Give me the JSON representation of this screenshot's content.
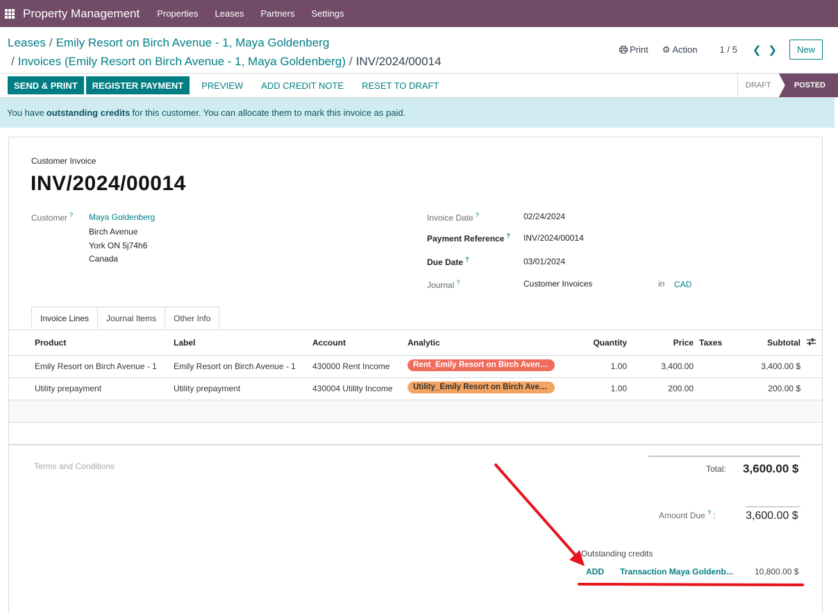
{
  "navbar": {
    "app_title": "Property Management",
    "menu": [
      "Properties",
      "Leases",
      "Partners",
      "Settings"
    ],
    "apps_icon": "grid-icon",
    "color": "#714b67"
  },
  "breadcrumb": {
    "item1": "Leases",
    "item2": "Emily Resort on Birch Avenue - 1, Maya Goldenberg",
    "item3": "Invoices (Emily Resort on Birch Avenue - 1, Maya Goldenberg)",
    "current": "INV/2024/00014"
  },
  "control": {
    "print_label": "Print",
    "print_icon": "printer-icon",
    "action_label": "Action",
    "action_icon": "gear-icon",
    "pager": "1 / 5",
    "new_label": "New"
  },
  "statusbar": {
    "buttons": [
      "SEND & PRINT",
      "REGISTER PAYMENT",
      "PREVIEW",
      "ADD CREDIT NOTE",
      "RESET TO DRAFT"
    ],
    "states": [
      "DRAFT",
      "POSTED"
    ],
    "active_state": "POSTED"
  },
  "alert": {
    "prefix": "You have",
    "bold": "outstanding credits",
    "suffix": "for this customer. You can allocate them to mark this invoice as paid."
  },
  "invoice": {
    "type_label": "Customer Invoice",
    "name": "INV/2024/00014",
    "customer_label": "Customer",
    "customer_name": "Maya Goldenberg",
    "address_line1": "Birch Avenue",
    "address_line2": "York ON 5j74h6",
    "address_line3": "Canada",
    "invoice_date_label": "Invoice Date",
    "invoice_date": "02/24/2024",
    "payment_ref_label": "Payment Reference",
    "payment_ref": "INV/2024/00014",
    "due_date_label": "Due Date",
    "due_date": "03/01/2024",
    "journal_label": "Journal",
    "journal": "Customer Invoices",
    "in_label": "in",
    "currency": "CAD"
  },
  "tabs": [
    "Invoice Lines",
    "Journal Items",
    "Other Info"
  ],
  "lines": {
    "headers": {
      "product": "Product",
      "label": "Label",
      "account": "Account",
      "analytic": "Analytic",
      "quantity": "Quantity",
      "price": "Price",
      "taxes": "Taxes",
      "subtotal": "Subtotal"
    },
    "rows": [
      {
        "product": "Emily Resort on Birch Avenue - 1",
        "label": "Emily Resort on Birch Avenue - 1",
        "account": "430000 Rent Income",
        "analytic": "Rent_Emily Resort on Birch Avenue...",
        "analytic_color": "#ef6b5b",
        "quantity": "1.00",
        "price": "3,400.00",
        "subtotal": "3,400.00 $"
      },
      {
        "product": "Utility prepayment",
        "label": "Utility prepayment",
        "account": "430004 Utility Income",
        "analytic": "Utility_Emily Resort on Birch Aven...",
        "analytic_color": "#f4a460",
        "quantity": "1.00",
        "price": "200.00",
        "subtotal": "200.00 $"
      }
    ]
  },
  "totals": {
    "terms_placeholder": "Terms and Conditions",
    "total_label": "Total:",
    "total_value": "3,600.00 $",
    "amount_due_label": "Amount Due",
    "amount_due_value": "3,600.00 $"
  },
  "outstanding": {
    "title": "Outstanding credits",
    "add_label": "ADD",
    "transaction": "Transaction Maya Goldenb...",
    "amount": "10,800.00 $"
  },
  "annotation": {
    "color": "#e8141c"
  }
}
